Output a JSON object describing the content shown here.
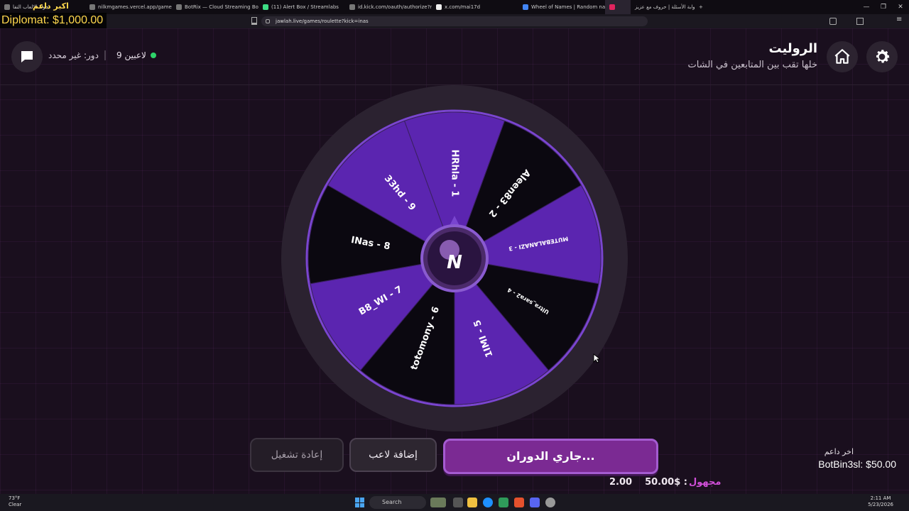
{
  "browser": {
    "tabs": [
      {
        "label": "جولة الالعاب التفا",
        "active": false
      },
      {
        "label": "nilkmgames.vercel.app/games/wheel",
        "active": false
      },
      {
        "label": "BotRix — Cloud Streaming Bot for Tw",
        "active": false
      },
      {
        "label": "(11) Alert Box / Streamlabs",
        "active": false
      },
      {
        "label": "id.kick.com/oauth/authorize?respon",
        "active": false
      },
      {
        "label": "x.com/mai17d",
        "active": false
      },
      {
        "label": "Wheel of Names | Random name pic",
        "active": false
      },
      {
        "label": "",
        "active": true
      },
      {
        "label": "بوابة الأسئلة | حروف مع عزيز",
        "active": false
      }
    ],
    "new_tab": "+",
    "url": "jawlah.live/games/roulette?kick=inas"
  },
  "overlay": {
    "donor": "Diplomat: $1,000.00",
    "mini": "اكبر داعم"
  },
  "header": {
    "title": "الروليت",
    "subtitle": "خلها تقب بين المتابعين في الشات",
    "players_count": "9 لاعبين",
    "turn": "دور: غير محدد"
  },
  "wheel": {
    "segments": [
      {
        "label": "HRhla - 1",
        "color": "#5b25b0"
      },
      {
        "label": "Aleen83 - 2",
        "color": "#0b0810"
      },
      {
        "label": "MUTEBALANAZI - 3",
        "color": "#5b25b0"
      },
      {
        "label": "Ultra_sara2 - 4",
        "color": "#0b0810"
      },
      {
        "label": "1IMI - 5",
        "color": "#5b25b0"
      },
      {
        "label": "totomony - 6",
        "color": "#0b0810"
      },
      {
        "label": "B8_WI - 7",
        "color": "#5b25b0"
      },
      {
        "label": "INas - 8",
        "color": "#0b0810"
      },
      {
        "label": "33hd - 9",
        "color": "#5b25b0"
      }
    ],
    "center_logo": "N"
  },
  "controls": {
    "spin_label": "جاري الدوران...",
    "add_player_label": "إضافة لاعب",
    "restart_label": "إعادة تشغيل"
  },
  "ticker": {
    "left": "2.00",
    "amount": "50.00$ :",
    "label": "مجهول"
  },
  "last_donor": {
    "label": "اخر داعم",
    "value": "BotBin3sl: $50.00"
  },
  "taskbar": {
    "weather_temp": "73°F",
    "weather_desc": "Clear",
    "search": "Search",
    "time": "2:11 AM",
    "date": "5/23/2026"
  },
  "colors": {
    "accent": "#7b2a93",
    "wheel_purple": "#5b25b0",
    "wheel_black": "#0b0810",
    "online": "#2ed46a"
  }
}
